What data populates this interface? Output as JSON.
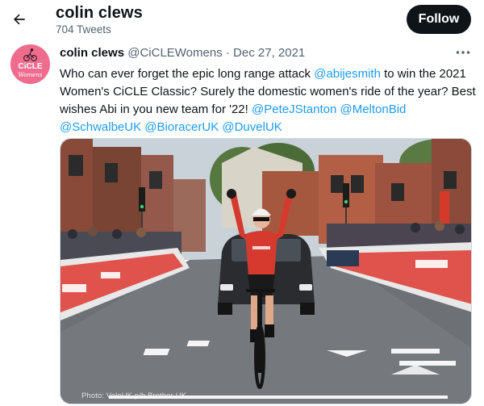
{
  "header": {
    "profile_name": "colin clews",
    "tweet_count": "704 Tweets",
    "follow_label": "Follow"
  },
  "tweet": {
    "author_name": "colin clews",
    "author_handle": "@CiCLEWomens",
    "separator": "·",
    "date": "Dec 27, 2021",
    "text_parts": {
      "p1": "Who can ever forget the epic long range attack ",
      "m1": "@abijesmith",
      "p2": " to win the 2021 Women's CiCLE Classic? Surely the domestic women's ride of the year? Best wishes Abi in you new team for '22! ",
      "m2": "@PeteJStanton",
      "s1": " ",
      "m3": "@MeltonBid",
      "s2": " ",
      "m4": "@SchwalbeUK",
      "s3": " ",
      "m5": "@BioracerUK",
      "s4": " ",
      "m6": "@DuvelUK"
    },
    "photo_credit": "Photo: VeloUK p/b Brother UK",
    "avatar_text": {
      "brand": "CiCLE",
      "script": "Womens"
    }
  },
  "icons": {
    "back": "arrow-left-icon",
    "more": "more-horizontal-icon"
  },
  "colors": {
    "accent": "#1d9bf0",
    "text": "#0f1419",
    "muted": "#536471",
    "follow_bg": "#0f1419",
    "avatar_bg": "#f06c8e",
    "jersey": "#d63a2f"
  }
}
